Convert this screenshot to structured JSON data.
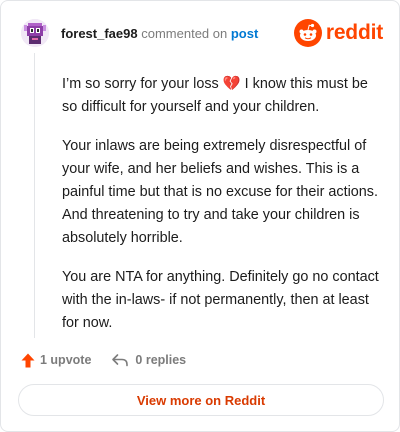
{
  "header": {
    "username": "forest_fae98",
    "action_text": "commented on",
    "post_link_label": "post",
    "logo_text": "reddit"
  },
  "comment": {
    "paragraphs": [
      {
        "before": "I’m so sorry for your loss ",
        "emoji": "💔",
        "after": " I know this must be so difficult for yourself and your children."
      },
      {
        "text": "Your inlaws are being extremely disrespectful of your wife, and her beliefs and wishes. This is a painful time but that is no excuse for their actions. And threatening to try and take your children is absolutely horrible."
      },
      {
        "text": "You are NTA for anything. Definitely go no contact with the in-laws- if not permanently, then at least for now."
      }
    ]
  },
  "footer": {
    "upvote_label": "1 upvote",
    "replies_label": "0 replies",
    "view_more_label": "View more on Reddit"
  },
  "colors": {
    "brand": "#ff4500",
    "link": "#0079d3",
    "muted": "#7c7c7c",
    "view_more_text": "#d93a00"
  },
  "icons": {
    "avatar": "avatar-icon",
    "logo": "reddit-logo-icon",
    "upvote": "upvote-arrow-icon",
    "reply": "reply-arrow-icon"
  }
}
